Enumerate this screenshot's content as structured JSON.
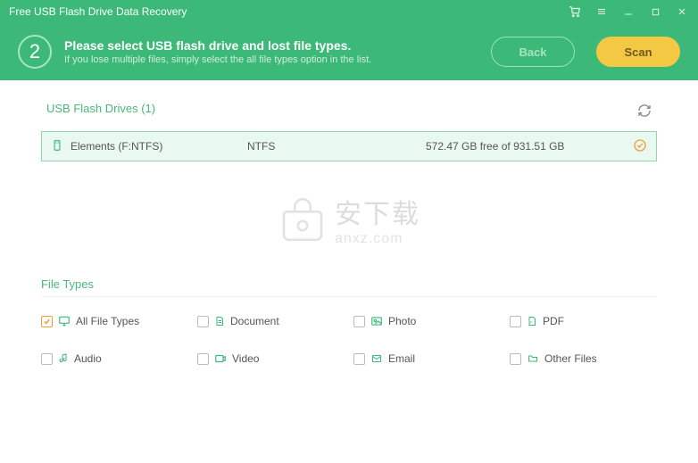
{
  "titlebar": {
    "title": "Free USB Flash Drive Data Recovery"
  },
  "header": {
    "step": "2",
    "main": "Please select USB flash drive and lost file types.",
    "sub": "If you lose multiple files, simply select the all file types option in the list.",
    "back": "Back",
    "scan": "Scan"
  },
  "drives": {
    "title": "USB Flash Drives (1)",
    "row": {
      "name": "Elements (F:NTFS)",
      "fs": "NTFS",
      "space": "572.47 GB free of 931.51 GB"
    }
  },
  "watermark": {
    "cn": "安下载",
    "en": "anxz.com"
  },
  "types": {
    "title": "File Types",
    "items": [
      {
        "label": "All File Types",
        "checked": true
      },
      {
        "label": "Document",
        "checked": false
      },
      {
        "label": "Photo",
        "checked": false
      },
      {
        "label": "PDF",
        "checked": false
      },
      {
        "label": "Audio",
        "checked": false
      },
      {
        "label": "Video",
        "checked": false
      },
      {
        "label": "Email",
        "checked": false
      },
      {
        "label": "Other Files",
        "checked": false
      }
    ]
  }
}
